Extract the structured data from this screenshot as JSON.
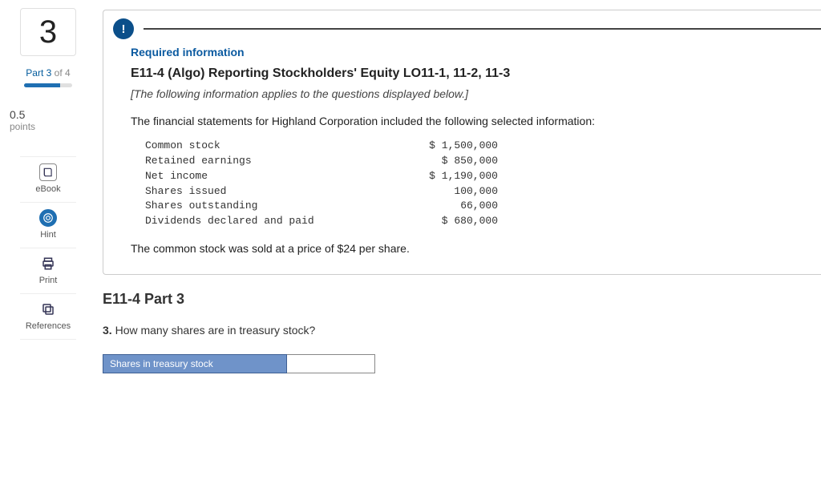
{
  "left": {
    "question_number": "3",
    "part_prefix": "Part ",
    "part_current": "3",
    "part_of": " of ",
    "part_total": "4",
    "points_value": "0.5",
    "points_label": "points",
    "tools": {
      "ebook": "eBook",
      "hint": "Hint",
      "print": "Print",
      "references": "References"
    }
  },
  "info": {
    "required": "Required information",
    "title": "E11-4 (Algo) Reporting Stockholders' Equity LO11-1, 11-2, 11-3",
    "applies": "[The following information applies to the questions displayed below.]",
    "lead": "The financial statements for Highland Corporation included the following selected information:",
    "rows": [
      {
        "label": "Common stock",
        "value": "$ 1,500,000"
      },
      {
        "label": "Retained earnings",
        "value": "$ 850,000"
      },
      {
        "label": "Net income",
        "value": "$ 1,190,000"
      },
      {
        "label": "Shares issued",
        "value": "100,000"
      },
      {
        "label": "Shares outstanding",
        "value": "66,000"
      },
      {
        "label": "Dividends declared and paid",
        "value": "$ 680,000"
      }
    ],
    "closing": "The common stock was sold at a price of $24 per share."
  },
  "part_heading": "E11-4 Part 3",
  "question": {
    "number": "3.",
    "text": " How many shares are in treasury stock?"
  },
  "answer": {
    "label": "Shares in treasury stock",
    "value": ""
  }
}
